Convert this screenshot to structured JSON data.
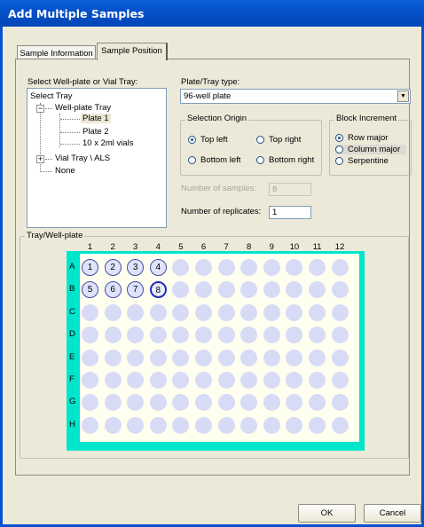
{
  "window": {
    "title": "Add Multiple Samples"
  },
  "tabs": [
    {
      "label": "Sample Information",
      "active": false
    },
    {
      "label": "Sample Position",
      "active": true
    }
  ],
  "tree": {
    "label": "Select Well-plate or Vial Tray:",
    "root": "Select Tray",
    "wellplate": "Well-plate Tray",
    "plate1": "Plate 1",
    "plate2": "Plate 2",
    "vials": "10 x 2ml vials",
    "vialtray": "Vial Tray \\ ALS",
    "none": "None",
    "collapse_glyph": "−",
    "expand_glyph": "+"
  },
  "platetype": {
    "label": "Plate/Tray type:",
    "value": "96-well plate",
    "arrow": "▼"
  },
  "origin": {
    "title": "Selection Origin",
    "options": [
      "Top left",
      "Top right",
      "Bottom left",
      "Bottom right"
    ],
    "selected": "Top left"
  },
  "block": {
    "title": "Block Increment",
    "options": [
      "Row major",
      "Column major",
      "Serpentine"
    ],
    "selected": "Row major"
  },
  "num_samples": {
    "label": "Number of samples:",
    "value": "8",
    "disabled": true
  },
  "num_replicates": {
    "label": "Number of replicates:",
    "value": "1"
  },
  "tray_label": "Tray/Well-plate",
  "plate": {
    "columns": [
      "1",
      "2",
      "3",
      "4",
      "5",
      "6",
      "7",
      "8",
      "9",
      "10",
      "11",
      "12"
    ],
    "rows": [
      "A",
      "B",
      "C",
      "D",
      "E",
      "F",
      "G",
      "H"
    ],
    "selected_wells": [
      {
        "row": "A",
        "col": "1",
        "num": "1"
      },
      {
        "row": "A",
        "col": "2",
        "num": "2"
      },
      {
        "row": "A",
        "col": "3",
        "num": "3"
      },
      {
        "row": "A",
        "col": "4",
        "num": "4"
      },
      {
        "row": "B",
        "col": "1",
        "num": "5"
      },
      {
        "row": "B",
        "col": "2",
        "num": "6"
      },
      {
        "row": "B",
        "col": "3",
        "num": "7"
      },
      {
        "row": "B",
        "col": "4",
        "num": "8"
      }
    ],
    "current_well": "8",
    "colors": {
      "outer": "#00e5cc",
      "inner": "#fffff0",
      "well": "#d8dbf6",
      "selected_border": "#434d9e"
    }
  },
  "buttons": {
    "ok": "OK",
    "cancel": "Cancel"
  }
}
